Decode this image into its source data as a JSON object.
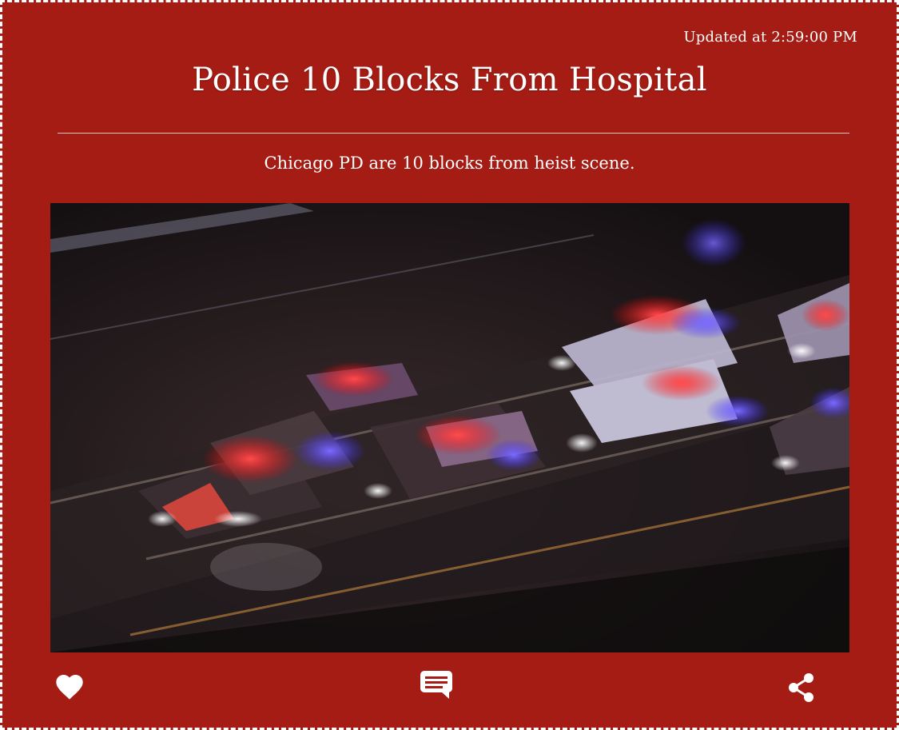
{
  "post": {
    "updated": "Updated at 2:59:00 PM",
    "title": "Police 10 Blocks From Hospital",
    "subtitle": "Chicago PD are 10 blocks from heist scene.",
    "image_alt": "Aerial night view of police vehicles with flashing lights on a road"
  },
  "actions": [
    {
      "name": "like",
      "icon": "heart-icon"
    },
    {
      "name": "comment",
      "icon": "comment-icon"
    },
    {
      "name": "share",
      "icon": "share-icon"
    }
  ],
  "colors": {
    "card_background": "#a51c14",
    "border": "#ffffff",
    "text": "#ffffff"
  }
}
